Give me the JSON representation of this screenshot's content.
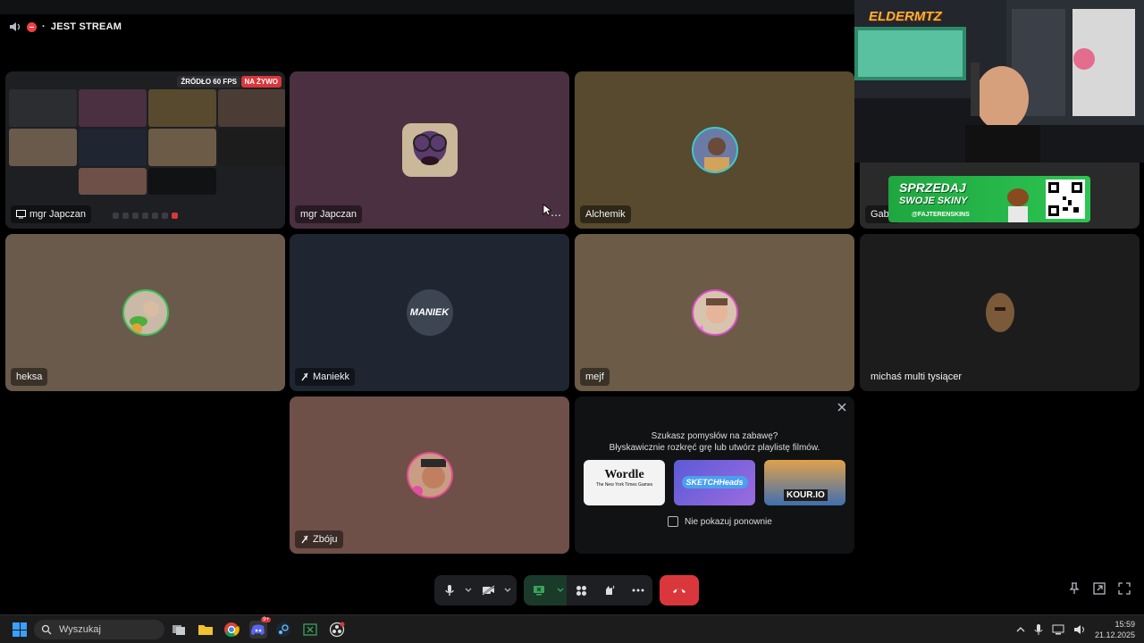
{
  "stream": {
    "title": "JEST STREAM"
  },
  "tiles": [
    {
      "name": "mgr Japczan",
      "type": "screen",
      "badge_fps": "ŹRÓDŁO 60 FPS",
      "badge_live": "NA ŻYWO",
      "color": "#1e1f22"
    },
    {
      "name": "mgr Japczan",
      "type": "camera",
      "color": "#4a3040"
    },
    {
      "name": "Alchemik",
      "color": "#574a2e"
    },
    {
      "name": "Gabe",
      "color": "#2a2a2a"
    },
    {
      "name": "heksa",
      "color": "#6a5a4c"
    },
    {
      "name": "Maniekk",
      "muted": true,
      "color": "#1f2631",
      "avatar_text": "MANIEK"
    },
    {
      "name": "mejf",
      "color": "#6b5b47"
    },
    {
      "name": "michaś multi tysiącer",
      "color": "#1c1c1c"
    },
    {
      "name": "Zbóju",
      "muted": true,
      "color": "#6e5048"
    }
  ],
  "overlay": {
    "logo_text": "ELDERMTZ",
    "ad_line1": "SPRZEDAJ",
    "ad_line2": "SWOJE SKINY",
    "ad_handle": "@FAJTERENSKINS"
  },
  "activity": {
    "line1": "Szukasz pomysłów na zabawę?",
    "line2": "Błyskawicznie rozkręć grę lub utwórz playlistę filmów.",
    "games": [
      {
        "name": "Wordle",
        "sub": "The New York Times Games"
      },
      {
        "name": "SKETCHHeads"
      },
      {
        "name": "KOUR.IO"
      }
    ],
    "dont_show": "Nie pokazuj ponownie"
  },
  "controls": {
    "mic": "microphone-icon",
    "camera": "camera-off-icon",
    "screenshare": "screen-share-icon",
    "activities": "activities-icon",
    "soundboard": "soundboard-icon",
    "more": "more-icon",
    "hangup": "hang-up-icon"
  },
  "taskbar": {
    "search_placeholder": "Wyszukaj",
    "discord_badge": "9+",
    "time": "15:59",
    "date": "21.12.2025"
  }
}
